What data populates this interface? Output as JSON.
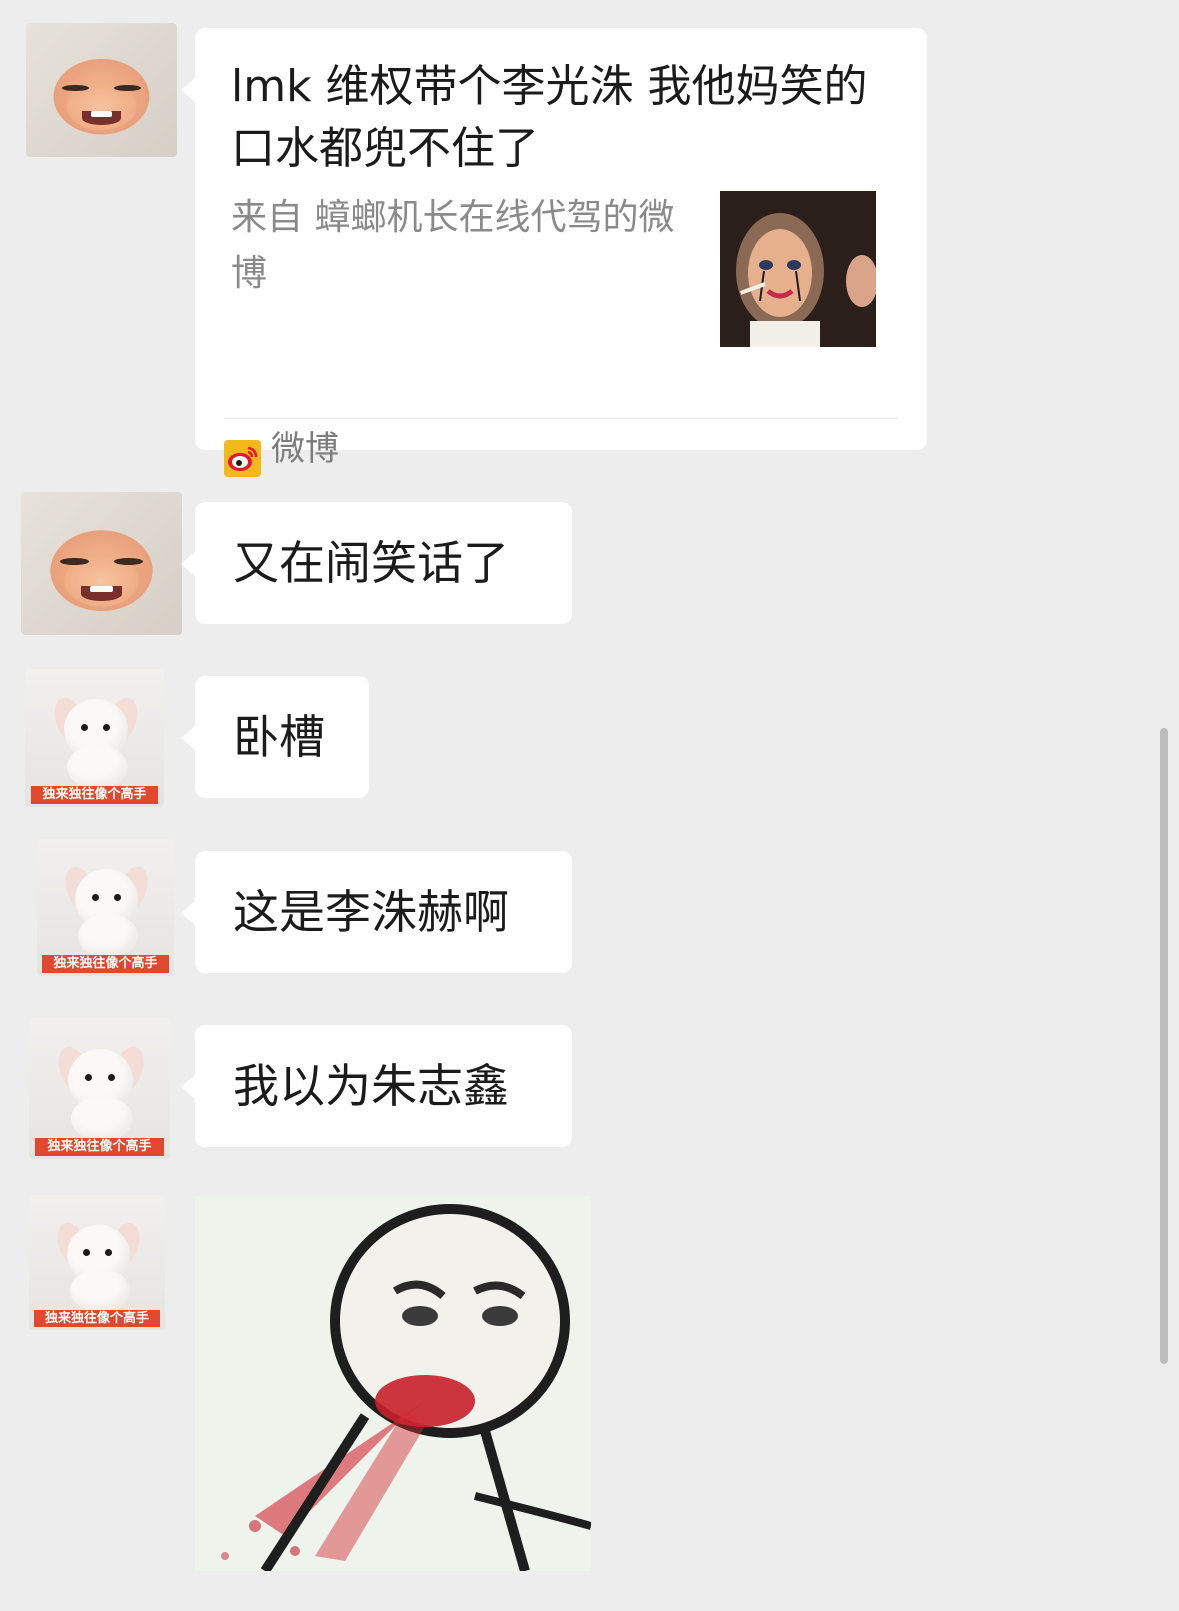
{
  "messages": [
    {
      "type": "share_card",
      "title": "lmk 维权带个李光洙 我他妈笑的口水都兜不住了",
      "subtitle": "来自 蟑螂机长在线代驾的微博",
      "source_label": "微博",
      "source_icon": "weibo-icon"
    },
    {
      "type": "text",
      "text": "又在闹笑话了"
    },
    {
      "type": "text",
      "text": "卧槽"
    },
    {
      "type": "text",
      "text": "这是李洙赫啊"
    },
    {
      "type": "text",
      "text": "我以为朱志鑫"
    },
    {
      "type": "sticker",
      "sticker": "spitting-blood-meme"
    }
  ],
  "avatars": {
    "bunny_caption": "独来独往像个高手"
  },
  "colors": {
    "background": "#ededed",
    "bubble": "#ffffff",
    "weibo_brand": "#e6162d",
    "weibo_yellow": "#f5b81a"
  }
}
